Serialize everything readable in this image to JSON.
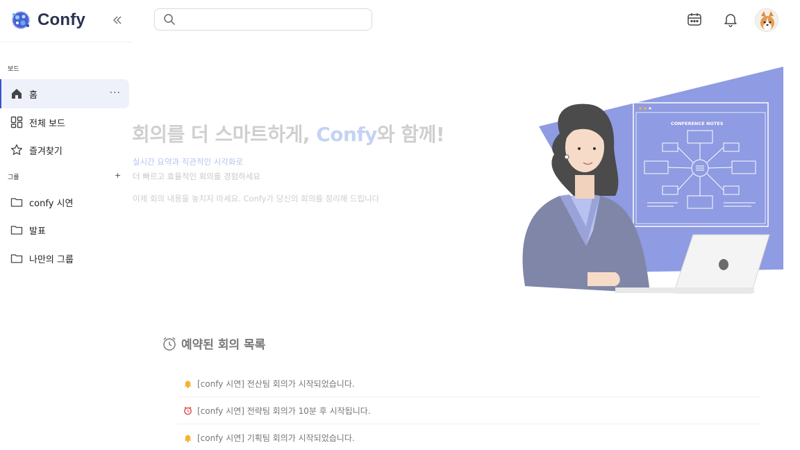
{
  "app": {
    "name": "Confy"
  },
  "search": {
    "placeholder": "",
    "value": ""
  },
  "sidebar": {
    "boards_section": "보드",
    "items": [
      {
        "label": "홈",
        "active": true
      },
      {
        "label": "전체 보드"
      },
      {
        "label": "즐겨찾기"
      }
    ],
    "groups_section": "그룹",
    "add_symbol": "+",
    "more_symbol": "···",
    "groups": [
      {
        "label": "confy 시연"
      },
      {
        "label": "발표"
      },
      {
        "label": "나만의 그룹"
      }
    ]
  },
  "hero": {
    "title_before": "회의를 더 스마트하게, ",
    "title_accent": "Confy",
    "title_after": "와 함께!",
    "subtitle1": "실시간 요약과 직관적인 시각화로",
    "subtitle2": "더 빠르고 효율적인 회의를 경험하세요",
    "subtitle3": "이제 회의 내용을 놓치지 마세요. Confy가 당신의 회의를 정리해 드립니다",
    "illustration_label": "CONFERENCE NOTES"
  },
  "scheduled": {
    "title": "예약된 회의 목록",
    "items": [
      {
        "icon": "bell-icon",
        "text": "[confy 시연] 전산팀 회의가 시작되었습니다."
      },
      {
        "icon": "alarm-clock-icon",
        "text": "[confy 시연] 전략팀 회의가 10분 후 시작됩니다."
      },
      {
        "icon": "bell-icon",
        "text": "[confy 시연] 기획팀 회의가 시작되었습니다."
      }
    ]
  },
  "colors": {
    "accent": "#3a55c8",
    "illustration_bg": "#8f9be2",
    "hero_accent": "#c4d2f4",
    "bell": "#f2b630",
    "alarm": "#e35050"
  }
}
